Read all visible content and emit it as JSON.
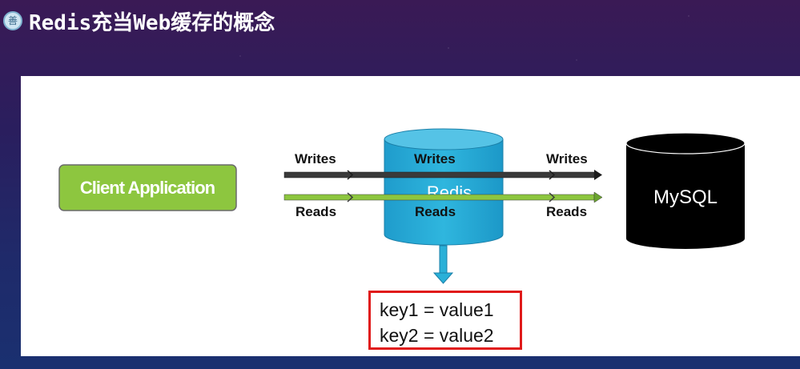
{
  "title": {
    "icon": "seal-icon",
    "icon_glyph": "善",
    "text": "Redis充当Web缓存的概念"
  },
  "diagram": {
    "client_label": "Client Application",
    "cache_label": "Redis",
    "db_label": "MySQL",
    "writes_label": "Writes",
    "reads_label": "Reads",
    "kv_lines": [
      "key1 = value1",
      "key2 = value2"
    ],
    "colors": {
      "client_fill": "#8dc63f",
      "cache_fill": "#29b0d8",
      "db_fill": "#000000",
      "writes_arrow": "#3a3a3a",
      "reads_arrow": "#8dc63f",
      "kv_border": "#e01a1a"
    }
  }
}
